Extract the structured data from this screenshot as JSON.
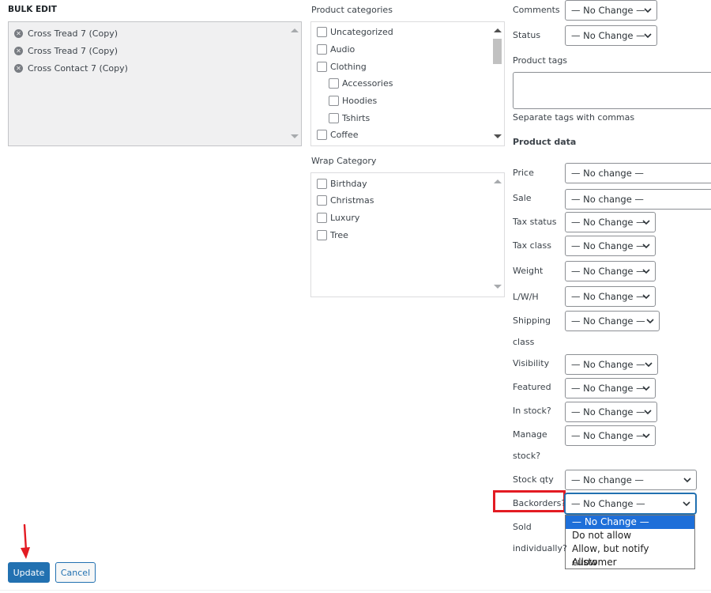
{
  "bulk_edit": {
    "title": "BULK EDIT",
    "posts": [
      "Cross Tread 7 (Copy)",
      "Cross Tread 7 (Copy)",
      "Cross Contact 7 (Copy)"
    ],
    "remove_icon": "remove-circle-icon"
  },
  "categories": {
    "title": "Product categories",
    "items": [
      "Uncategorized",
      "Audio",
      "Clothing",
      "Accessories",
      "Hoodies",
      "Tshirts",
      "Coffee"
    ]
  },
  "wrap": {
    "title": "Wrap Category",
    "items": [
      "Birthday",
      "Christmas",
      "Luxury",
      "Tree"
    ]
  },
  "fields": {
    "comments": {
      "label": "Comments",
      "value": "— No Change —"
    },
    "status": {
      "label": "Status",
      "value": "— No Change —"
    },
    "tags": {
      "label": "Product tags",
      "hint": "Separate tags with commas"
    },
    "product_data_title": "Product data",
    "price": {
      "label": "Price",
      "value": "— No change —"
    },
    "sale": {
      "label": "Sale",
      "value": "— No change —"
    },
    "tax_status": {
      "label": "Tax status",
      "value": "— No Change —"
    },
    "tax_class": {
      "label": "Tax class",
      "value": "— No Change —"
    },
    "weight": {
      "label": "Weight",
      "value": "— No Change —"
    },
    "lwh": {
      "label": "L/W/H",
      "value": "— No Change —"
    },
    "shipping_class": {
      "label_line1": "Shipping",
      "label_line2": "class",
      "value": "— No Change —"
    },
    "visibility": {
      "label": "Visibility",
      "value": "— No Change —"
    },
    "featured": {
      "label": "Featured",
      "value": "— No Change —"
    },
    "in_stock": {
      "label": "In stock?",
      "value": "— No Change —"
    },
    "manage_stock": {
      "label_line1": "Manage",
      "label_line2": "stock?",
      "value": "— No Change —"
    },
    "stock_qty": {
      "label": "Stock qty",
      "value": "— No change —"
    },
    "backorders": {
      "label": "Backorders?",
      "value": "— No Change —",
      "options": [
        "— No Change —",
        "Do not allow",
        "Allow, but notify customer",
        "Allow"
      ],
      "selected_index": 0
    },
    "sold_individually": {
      "label_line1": "Sold",
      "label_line2": "individually?"
    }
  },
  "actions": {
    "update": "Update",
    "cancel": "Cancel"
  },
  "colors": {
    "primary": "#2271b1",
    "highlight": "#e31b23",
    "option_selected": "#1e6fd9"
  }
}
